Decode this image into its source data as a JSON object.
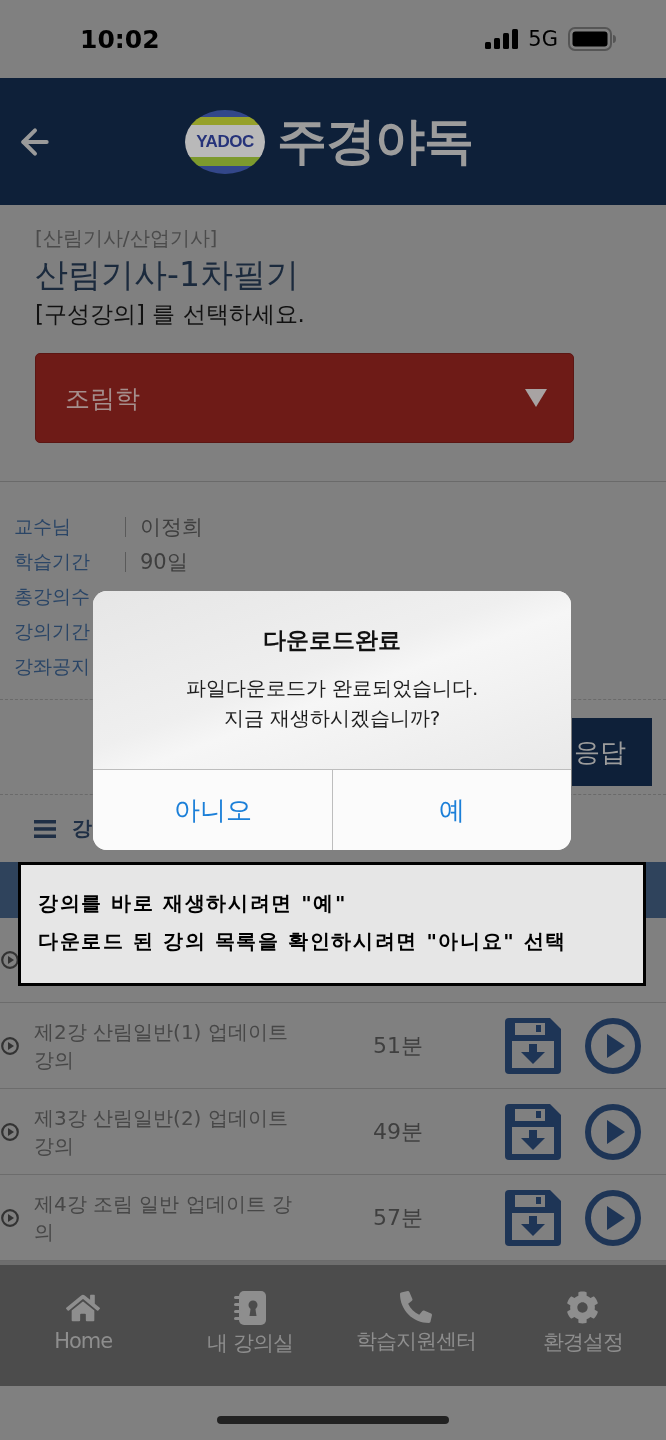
{
  "status_bar": {
    "time": "10:02",
    "network": "5G"
  },
  "header": {
    "logo_badge": "YADOC",
    "logo_text": "주경야독"
  },
  "course": {
    "category": "[산림기사/산업기사]",
    "title": "산림기사-1차필기",
    "instruction": "[구성강의] 를 선택하세요.",
    "dropdown": {
      "value": "조림학"
    }
  },
  "info": [
    {
      "label": "교수님",
      "value": "이정희"
    },
    {
      "label": "학습기간",
      "value": "90일"
    },
    {
      "label": "총강의수"
    },
    {
      "label": "강의기간"
    },
    {
      "label": "강좌공지"
    }
  ],
  "action_button": {
    "label": "응답"
  },
  "lecture_section": {
    "title": "강"
  },
  "lectures": [
    {
      "title": "제2강 산림일반(1) 업데이트 강의",
      "duration": "51분"
    },
    {
      "title": "제3강 산림일반(2) 업데이트 강의",
      "duration": "49분"
    },
    {
      "title": "제4강 조림 일반 업데이트 강의",
      "duration": "57분"
    }
  ],
  "bottom_nav": [
    {
      "kind": "home",
      "label": "Home"
    },
    {
      "kind": "classroom",
      "label": "내 강의실"
    },
    {
      "kind": "support",
      "label": "학습지원센터"
    },
    {
      "kind": "settings",
      "label": "환경설정"
    }
  ],
  "dialog": {
    "title": "다운로드완료",
    "message": "파일다운로드가 완료되었습니다.\n지금 재생하시겠습니까?",
    "buttons": [
      "아니오",
      "예"
    ]
  },
  "annotation": {
    "lines": [
      "강의를 바로 재생하시려면 \"예\"",
      "다운로드 된 강의 목록을 확인하시려면 \"아니요\" 선택"
    ]
  }
}
